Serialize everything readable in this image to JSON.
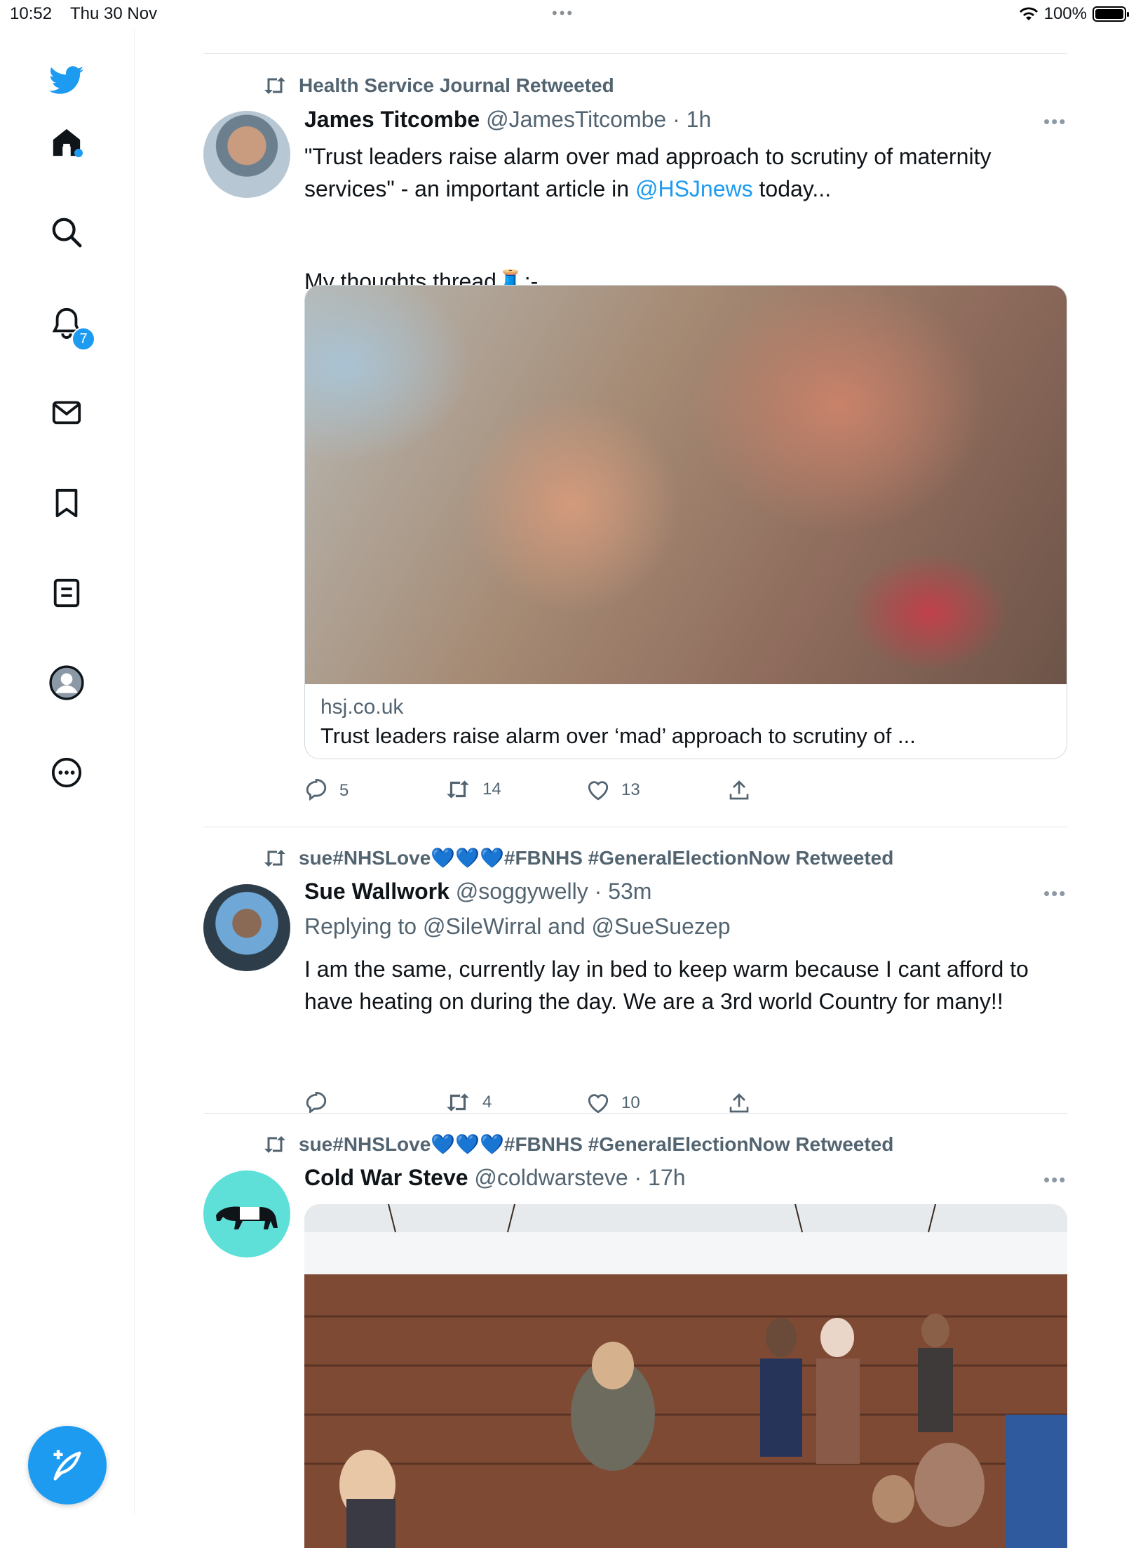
{
  "status_bar": {
    "time": "10:52",
    "date": "Thu 30 Nov",
    "battery": "100%"
  },
  "sidebar": {
    "items": [
      {
        "name": "twitter-logo-icon"
      },
      {
        "name": "home-icon"
      },
      {
        "name": "search-icon"
      },
      {
        "name": "notifications-icon",
        "badge": "7"
      },
      {
        "name": "messages-icon"
      },
      {
        "name": "bookmarks-icon"
      },
      {
        "name": "lists-icon"
      },
      {
        "name": "profile-icon"
      },
      {
        "name": "more-icon"
      }
    ],
    "compose": {
      "name": "compose-tweet-icon"
    }
  },
  "tweets": [
    {
      "retweeted_by": "Health Service Journal Retweeted",
      "name": "James Titcombe",
      "handle": "@JamesTitcombe",
      "time": "· 1h",
      "text_1": "\"Trust leaders raise alarm over mad approach to scrutiny of maternity services\" - an important article in ",
      "mention": "@HSJnews",
      "text_2": " today...",
      "text_3": "My thoughts thread",
      "text_4": ":-",
      "card": {
        "domain": "hsj.co.uk",
        "title": "Trust leaders raise alarm over ‘mad’ approach to scrutiny of ..."
      },
      "replies": "5",
      "retweets": "14",
      "likes": "13"
    },
    {
      "retweeted_by": "sue#NHSLove💙💙💙#FBNHS #GeneralElectionNow Retweeted",
      "name": "Sue Wallwork",
      "handle": "@soggywelly",
      "time": "· 53m",
      "replying_label": "Replying to ",
      "replying_to": "@SileWirral and @SueSuezep",
      "text": "I am the same, currently lay in bed to keep warm because I cant afford to have heating on during the day. We are a 3rd world Country for many!!",
      "replies": "",
      "retweets": "4",
      "likes": "10"
    },
    {
      "retweeted_by": "sue#NHSLove💙💙💙#FBNHS #GeneralElectionNow Retweeted",
      "name": "Cold War Steve",
      "handle": "@coldwarsteve",
      "time": "· 17h"
    }
  ],
  "colors": {
    "accent": "#1d9bf0",
    "secondary_text": "#536471",
    "divider": "#e1e6ea"
  }
}
